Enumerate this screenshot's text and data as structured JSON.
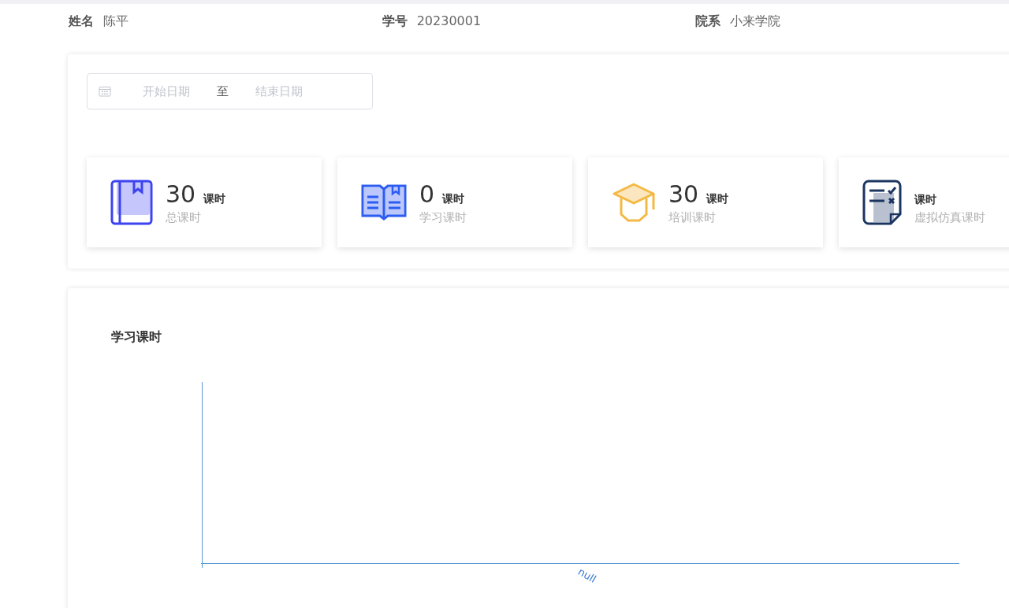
{
  "student": [
    {
      "label": "姓名",
      "value": "陈平"
    },
    {
      "label": "学号",
      "value": "20230001"
    },
    {
      "label": "院系",
      "value": "小来学院"
    }
  ],
  "date_range": {
    "start_placeholder": "开始日期",
    "separator": "至",
    "end_placeholder": "结束日期"
  },
  "stats": [
    {
      "kind": "book",
      "value": "30",
      "unit": "课时",
      "label": "总课时"
    },
    {
      "kind": "open-book",
      "value": "0",
      "unit": "课时",
      "label": "学习课时"
    },
    {
      "kind": "cap",
      "value": "30",
      "unit": "课时",
      "label": "培训课时"
    },
    {
      "kind": "checklist",
      "unit": "课时",
      "label": "虚拟仿真课时"
    }
  ],
  "chart": {
    "title": "学习课时",
    "category_label": "null"
  }
}
